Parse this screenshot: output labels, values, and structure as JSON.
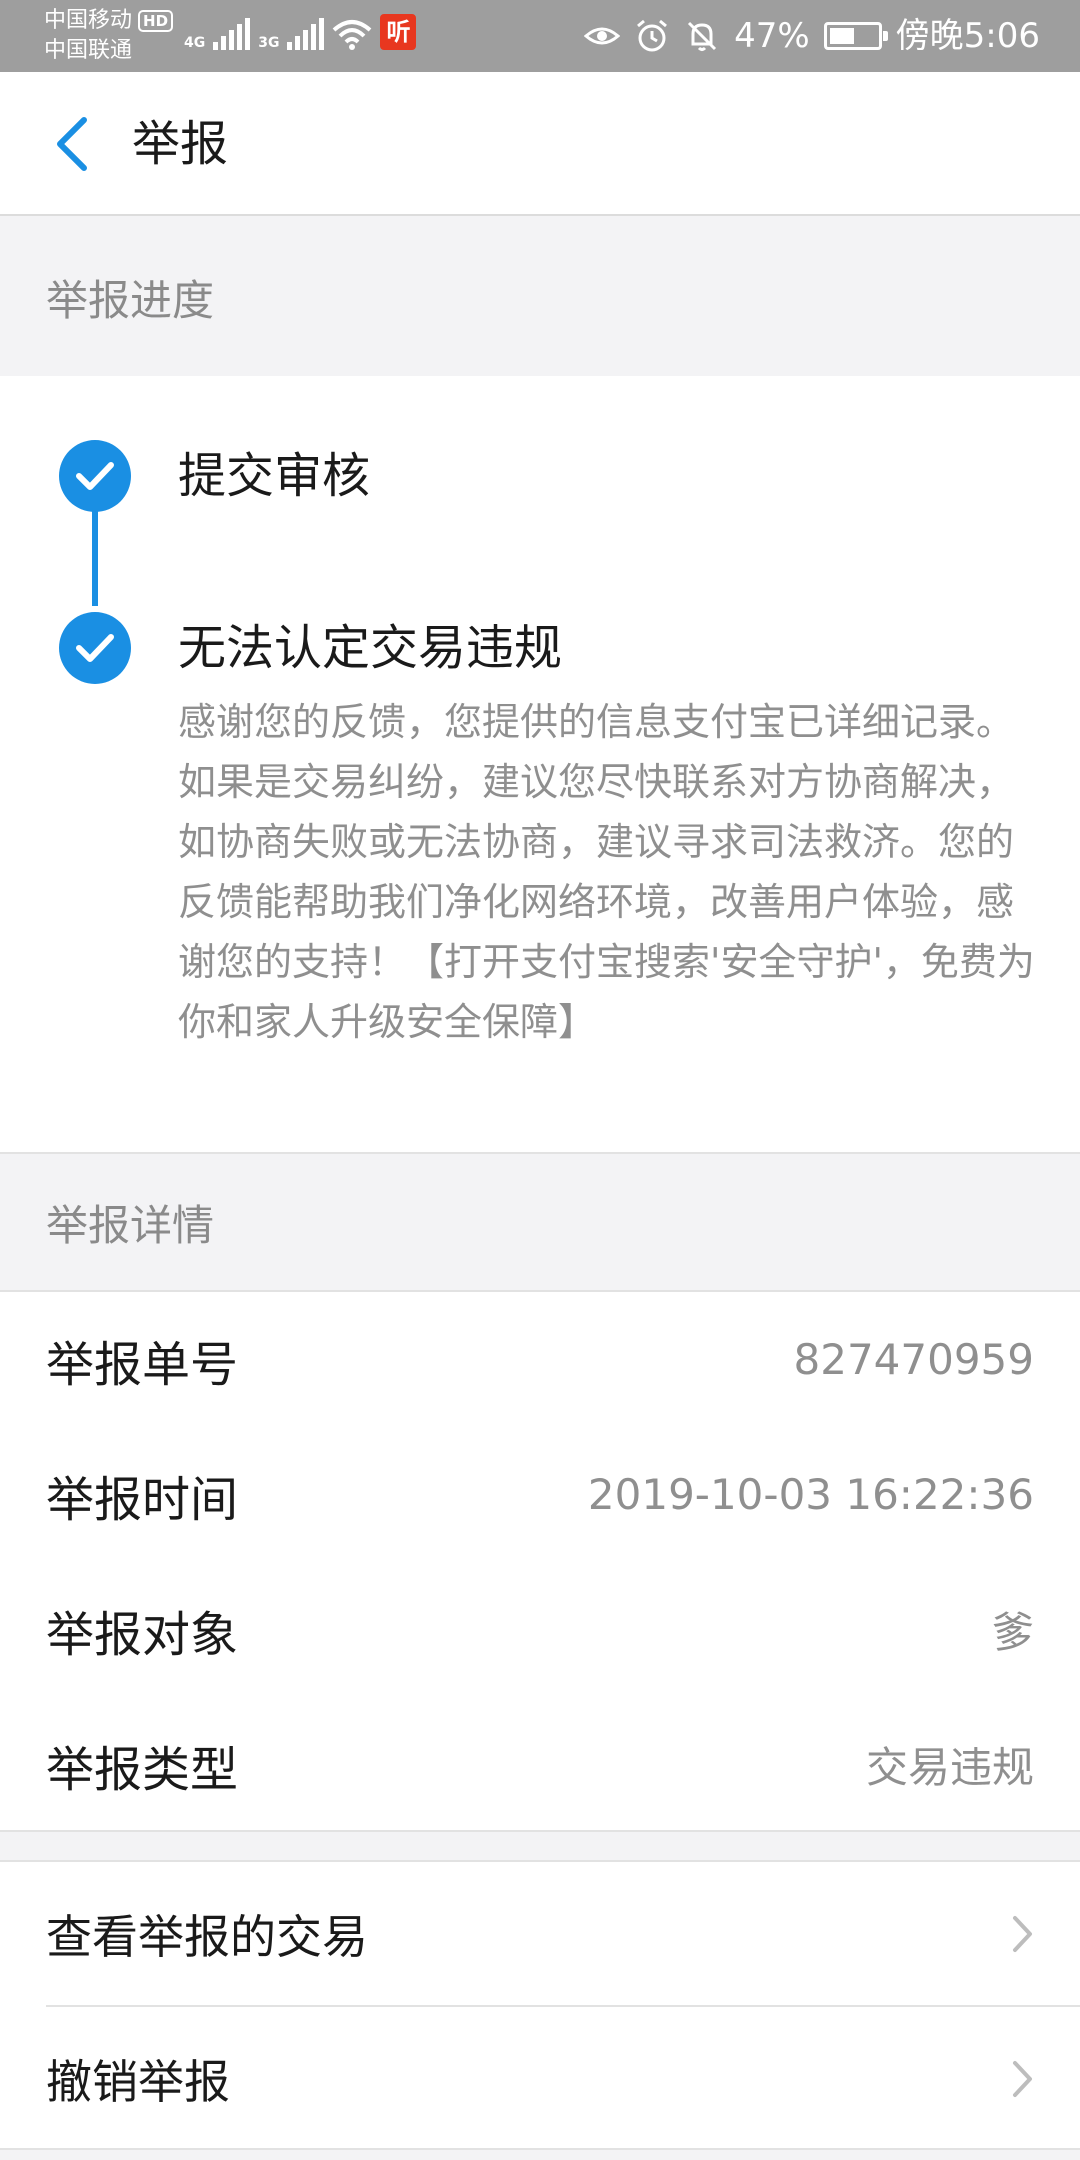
{
  "status_bar": {
    "carrier_1": "中国移动",
    "carrier_1_badge": "HD",
    "carrier_2": "中国联通",
    "net_1": "4G",
    "net_2": "3G",
    "app_badge": "听",
    "battery": "47%",
    "time": "傍晚5:06"
  },
  "nav": {
    "title": "举报"
  },
  "progress": {
    "header": "举报进度",
    "steps": [
      {
        "title": "提交审核"
      },
      {
        "title": "无法认定交易违规",
        "description": "感谢您的反馈，您提供的信息支付宝已详细记录。如果是交易纠纷，建议您尽快联系对方协商解决，如协商失败或无法协商，建议寻求司法救济。您的反馈能帮助我们净化网络环境，改善用户体验，感谢您的支持！【打开支付宝搜索'安全守护'，免费为你和家人升级安全保障】"
      }
    ]
  },
  "details": {
    "header": "举报详情",
    "rows": [
      {
        "label": "举报单号",
        "value": "827470959"
      },
      {
        "label": "举报时间",
        "value": "2019-10-03 16:22:36"
      },
      {
        "label": "举报对象",
        "value": "爹"
      },
      {
        "label": "举报类型",
        "value": "交易违规"
      }
    ]
  },
  "actions": [
    {
      "label": "查看举报的交易"
    },
    {
      "label": "撤销举报"
    }
  ],
  "colors": {
    "accent": "#1a8fe3",
    "status_bar": "#9e9e9e",
    "background": "#f3f3f5"
  }
}
